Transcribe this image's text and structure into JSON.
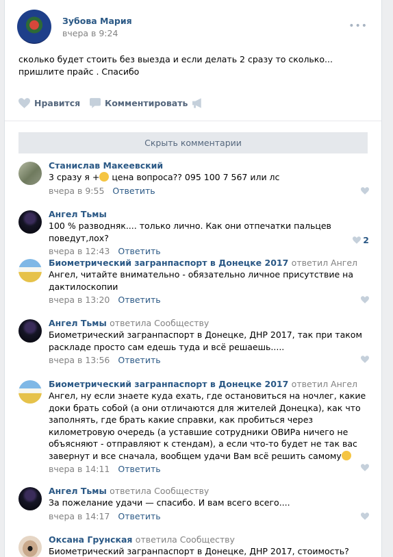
{
  "post": {
    "author": "Зубова Мария",
    "time": "вчера в 9:24",
    "text": "сколько будет стоить без выезда и если делать 2 сразу то сколько... пришлите прайс . Спасибо",
    "more": "•••",
    "actions": {
      "like_label": "Нравится",
      "comment_label": "Комментировать"
    },
    "hide_comments_label": "Скрыть комментарии"
  },
  "comments": [
    {
      "author": "Станислав Макеевский",
      "reply_to": "",
      "text_before_emoji": "3 сразу я +",
      "text_after_emoji": " цена вопроса?? 095 100 7 567 или лс",
      "time": "вчера в 9:55",
      "answer": "Ответить",
      "likes": ""
    },
    {
      "author": "Ангел Тьмы",
      "reply_to": "",
      "text": "100 % разводняк.... только лично. Как они отпечатки пальцев поведут,лох?",
      "time": "вчера в 12:43",
      "answer": "Ответить",
      "likes": "2"
    },
    {
      "author": "Биометрический загранпаспорт в Донецке 2017",
      "reply_to": "ответил Ангел",
      "text": "Ангел, читайте внимательно - обязательно личное присутствие на дактилоскопии",
      "time": "вчера в 13:20",
      "answer": "Ответить",
      "likes": ""
    },
    {
      "author": "Ангел Тьмы",
      "reply_to": "ответила Сообществу",
      "text": "Биометрический загранпаспорт в Донецке, ДНР 2017, так при таком раскладе просто сам едешь туда и всё решаешь.....",
      "time": "вчера в 13:56",
      "answer": "Ответить",
      "likes": ""
    },
    {
      "author": "Биометрический загранпаспорт в Донецке 2017",
      "reply_to": "ответил Ангел",
      "text": "Ангел, ну если знаете куда ехать, где остановиться на ночлег, какие доки брать собой (а они отличаются для жителей Донецка), как что заполнять, где брать какие справки, как пробиться через километровую очередь (а уставшие сотрудники ОВИРа ничего не объясняют - отправляют к стендам), а если что-то будет не так вас завернут и все сначала, вообщем удачи Вам всё решить самому",
      "time": "вчера в 14:11",
      "answer": "Ответить",
      "likes": ""
    },
    {
      "author": "Ангел Тьмы",
      "reply_to": "ответила Сообществу",
      "text": "За пожелание удачи — спасибо. И вам всего всего....",
      "time": "вчера в 14:17",
      "answer": "Ответить",
      "likes": ""
    },
    {
      "author": "Оксана Грунская",
      "reply_to": "ответила Сообществу",
      "text": "Биометрический загранпаспорт в Донецке, ДНР 2017, стоимость?",
      "time": "",
      "answer": "",
      "likes": ""
    }
  ]
}
